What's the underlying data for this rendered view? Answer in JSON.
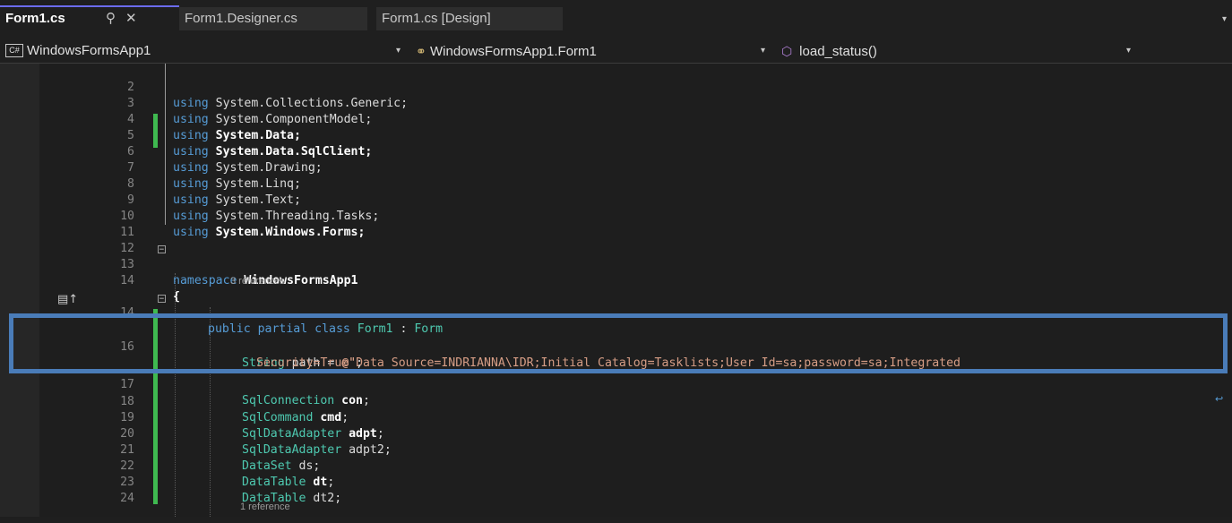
{
  "tabs": [
    {
      "label": "Form1.cs",
      "pin": "⚲",
      "close": "✕",
      "active": true
    },
    {
      "label": "Form1.Designer.cs",
      "active": false
    },
    {
      "label": "Form1.cs [Design]",
      "active": false
    }
  ],
  "nav": {
    "project_badge": "C#",
    "project": "WindowsFormsApp1",
    "class": "WindowsFormsApp1.Form1",
    "member": "load_status()"
  },
  "codelens": {
    "class_refs": "3 references",
    "member_refs": "1 reference"
  },
  "lines": [
    {
      "n": "2"
    },
    {
      "n": "3"
    },
    {
      "n": "4"
    },
    {
      "n": "5"
    },
    {
      "n": "6"
    },
    {
      "n": "7"
    },
    {
      "n": "8"
    },
    {
      "n": "9"
    },
    {
      "n": "10"
    },
    {
      "n": "11"
    },
    {
      "n": "12"
    },
    {
      "n": "13"
    },
    {
      "n": "14"
    },
    {
      "n": "16"
    },
    {
      "n": "17"
    },
    {
      "n": "18"
    },
    {
      "n": "19"
    },
    {
      "n": "20"
    },
    {
      "n": "21"
    },
    {
      "n": "22"
    },
    {
      "n": "23"
    },
    {
      "n": "24"
    }
  ],
  "code": {
    "kw_using": "using",
    "l2_ns": "System.Collections.Generic;",
    "l3_ns": "System.ComponentModel;",
    "l4_ns": "System.Data;",
    "l5_ns": "System.Data.SqlClient;",
    "l6_ns": "System.Drawing;",
    "l7_ns": "System.Linq;",
    "l8_ns": "System.Text;",
    "l9_ns": "System.Threading.Tasks;",
    "l10_ns": "System.Windows.Forms;",
    "kw_namespace": "namespace",
    "namespace_name": "WindowsFormsApp1",
    "open_brace": "{",
    "kw_public": "public",
    "kw_partial": "partial",
    "kw_class": "class",
    "class_name": "Form1",
    "colon": ":",
    "base_class": "Form",
    "t_string": "String",
    "f_path": "path",
    "eq": "=",
    "path_value_1": "@\"Data Source=INDRIANNA\\IDR;Initial Catalog=Tasklists;User Id=sa;password=sa;Integrated",
    "path_value_2": "Security=True\"",
    "semi": ";",
    "t_conn": "SqlConnection",
    "f_con": "con",
    "t_cmd": "SqlCommand",
    "f_cmd": "cmd",
    "t_adapter": "SqlDataAdapter",
    "f_adpt": "adpt",
    "f_adpt2": "adpt2",
    "t_dataset": "DataSet",
    "f_ds": "ds",
    "t_datatable": "DataTable",
    "f_dt": "dt",
    "f_dt2": "dt2"
  },
  "icons": {
    "pin": "pin-icon",
    "close": "close-icon",
    "class_icon": "class-icon",
    "method_icon": "method-icon",
    "change_marker": "breakpoint-marker-icon",
    "wrap": "word-wrap-icon"
  },
  "colors": {
    "keyword": "#569cd6",
    "type": "#4ec9b0",
    "string": "#d69d85",
    "change_bar": "#3fb950",
    "highlight": "#4a7cb8"
  }
}
